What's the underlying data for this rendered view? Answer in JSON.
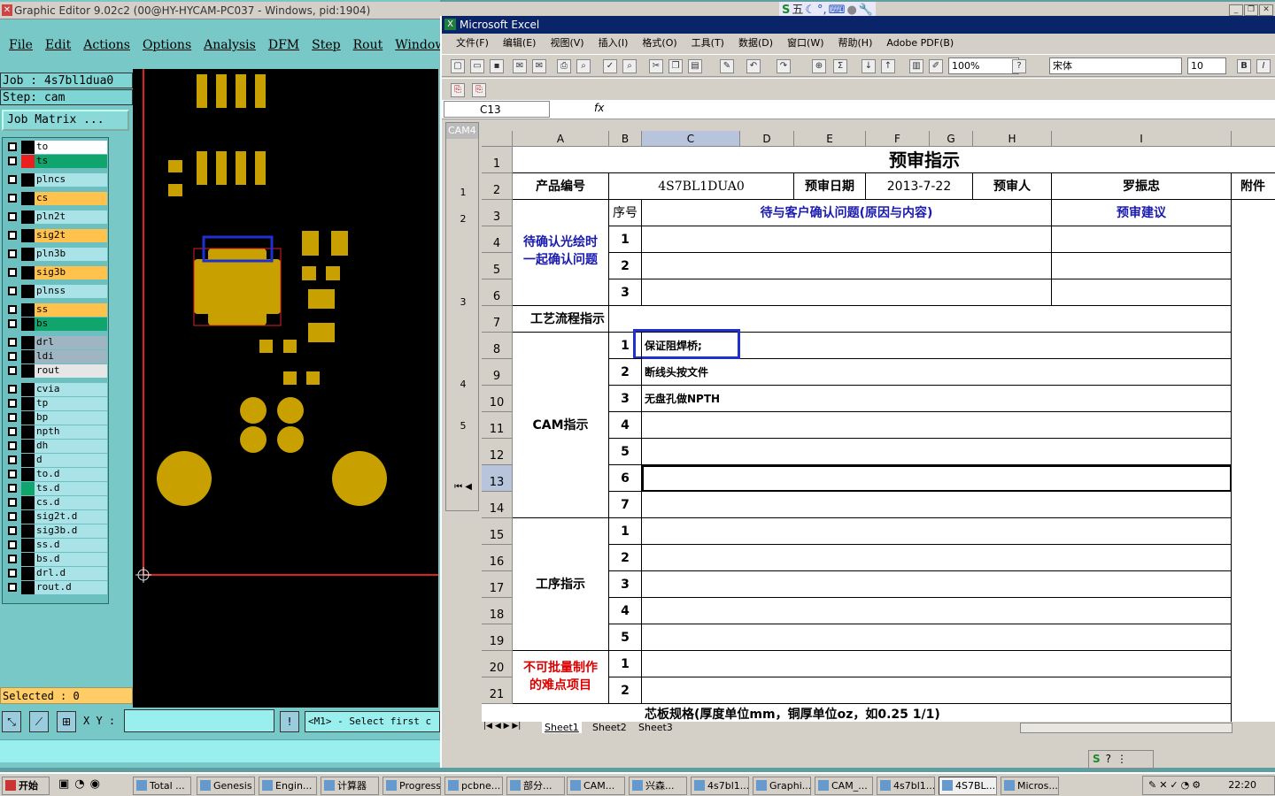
{
  "ge": {
    "title": "Graphic Editor 9.02c2 (00@HY-HYCAM-PC037 - Windows, pid:1904)",
    "menu": [
      "File",
      "Edit",
      "Actions",
      "Options",
      "Analysis",
      "DFM",
      "Step",
      "Rout",
      "Windows"
    ],
    "job": "Job : 4s7bl1dua0",
    "step": "Step: cam",
    "job_matrix": "Job Matrix ...",
    "layers": [
      {
        "name": "to",
        "color": "#ffffff",
        "sel": "#000000"
      },
      {
        "name": "ts",
        "color": "#11a56e",
        "sel": "#e82020"
      },
      {
        "name": "plncs",
        "color": "#a9e3e8",
        "sel": "#000000"
      },
      {
        "name": "cs",
        "color": "#ffc24d",
        "sel": "#000000"
      },
      {
        "name": "pln2t",
        "color": "#a9e3e8",
        "sel": "#000000"
      },
      {
        "name": "sig2t",
        "color": "#ffc24d",
        "sel": "#000000"
      },
      {
        "name": "pln3b",
        "color": "#a9e3e8",
        "sel": "#000000"
      },
      {
        "name": "sig3b",
        "color": "#ffc24d",
        "sel": "#000000"
      },
      {
        "name": "plnss",
        "color": "#a9e3e8",
        "sel": "#000000"
      },
      {
        "name": "ss",
        "color": "#ffc24d",
        "sel": "#000000"
      },
      {
        "name": "bs",
        "color": "#11a56e",
        "sel": "#000000"
      },
      {
        "name": "drl",
        "color": "#9fb5c2",
        "sel": "#000000"
      },
      {
        "name": "ldi",
        "color": "#9fb5c2",
        "sel": "#000000"
      },
      {
        "name": "rout",
        "color": "#e6e6e6",
        "sel": "#000000"
      },
      {
        "name": "cvia",
        "color": "#a9e3e8",
        "sel": "#000000"
      },
      {
        "name": "tp",
        "color": "#a9e3e8",
        "sel": "#000000"
      },
      {
        "name": "bp",
        "color": "#a9e3e8",
        "sel": "#000000"
      },
      {
        "name": "npth",
        "color": "#a9e3e8",
        "sel": "#000000"
      },
      {
        "name": "dh",
        "color": "#a9e3e8",
        "sel": "#000000"
      },
      {
        "name": "d",
        "color": "#a9e3e8",
        "sel": "#000000"
      },
      {
        "name": "to.d",
        "color": "#a9e3e8",
        "sel": "#000000"
      },
      {
        "name": "ts.d",
        "color": "#a9e3e8",
        "sel": "#11a56e"
      },
      {
        "name": "cs.d",
        "color": "#a9e3e8",
        "sel": "#000000"
      },
      {
        "name": "sig2t.d",
        "color": "#a9e3e8",
        "sel": "#000000"
      },
      {
        "name": "sig3b.d",
        "color": "#a9e3e8",
        "sel": "#000000"
      },
      {
        "name": "ss.d",
        "color": "#a9e3e8",
        "sel": "#000000"
      },
      {
        "name": "bs.d",
        "color": "#a9e3e8",
        "sel": "#000000"
      },
      {
        "name": "drl.d",
        "color": "#a9e3e8",
        "sel": "#000000"
      },
      {
        "name": "rout.d",
        "color": "#a9e3e8",
        "sel": "#000000"
      }
    ],
    "selected": "Selected : 0",
    "xy_label": "X Y :",
    "message": "<M1> - Select first c"
  },
  "xl": {
    "title": "Microsoft Excel",
    "menu": [
      "文件(F)",
      "编辑(E)",
      "视图(V)",
      "插入(I)",
      "格式(O)",
      "工具(T)",
      "数据(D)",
      "窗口(W)",
      "帮助(H)",
      "Adobe PDF(B)"
    ],
    "zoom": "100%",
    "font": "宋体",
    "size": "10",
    "namebox": "C13",
    "fx": "fx",
    "cam_label": "CAM4",
    "cam_rows": [
      "1",
      "2",
      "3",
      "4",
      "5"
    ],
    "columns": [
      "A",
      "B",
      "C",
      "D",
      "E",
      "F",
      "G",
      "H",
      "I"
    ],
    "rows": [
      "1",
      "2",
      "3",
      "4",
      "5",
      "6",
      "7",
      "8",
      "9",
      "10",
      "11",
      "12",
      "13",
      "14",
      "15",
      "16",
      "17",
      "18",
      "19",
      "20",
      "21"
    ],
    "cells": {
      "title": "预审指示",
      "product_no_label": "产品编号",
      "product_no": "4S7BL1DUA0",
      "review_date_label": "预审日期",
      "review_date": "2013-7-22",
      "reviewer_label": "预审人",
      "reviewer": "罗振忠",
      "attach": "附件",
      "seq": "序号",
      "pending_header": "待与客户确认问题(原因与内容)",
      "advice_header": "预审建议",
      "pending_label_1": "待确认光绘时",
      "pending_label_2": "一起确认问题",
      "flow_label": "工艺流程指示",
      "cam_label": "CAM指示",
      "cam_item_1": "保证阻焊桥;",
      "cam_item_2": "断线头按文件",
      "cam_item_3": "无盘孔做NPTH",
      "process_label": "工序指示",
      "hard_label_1": "不可批量制作",
      "hard_label_2": "的难点项目",
      "core_spec": "芯板规格(厚度单位mm，铜厚单位oz，如0.25 1/1)"
    },
    "tabs": [
      "Sheet1",
      "Sheet2",
      "Sheet3"
    ]
  },
  "taskbar": {
    "start": "开始",
    "items": [
      "Total ...",
      "Genesis",
      "Engin...",
      "计算器",
      "Progress",
      "pcbne...",
      "部分...",
      "CAM...",
      "兴森...",
      "4s7bl1...",
      "Graphi...",
      "CAM_...",
      "4s7bl1...",
      "4S7BL...",
      "Micros..."
    ],
    "time": "22:20"
  },
  "ime": {
    "items": [
      "S",
      "五",
      "☾",
      "°,",
      "⌨",
      "●",
      "🔧"
    ]
  }
}
